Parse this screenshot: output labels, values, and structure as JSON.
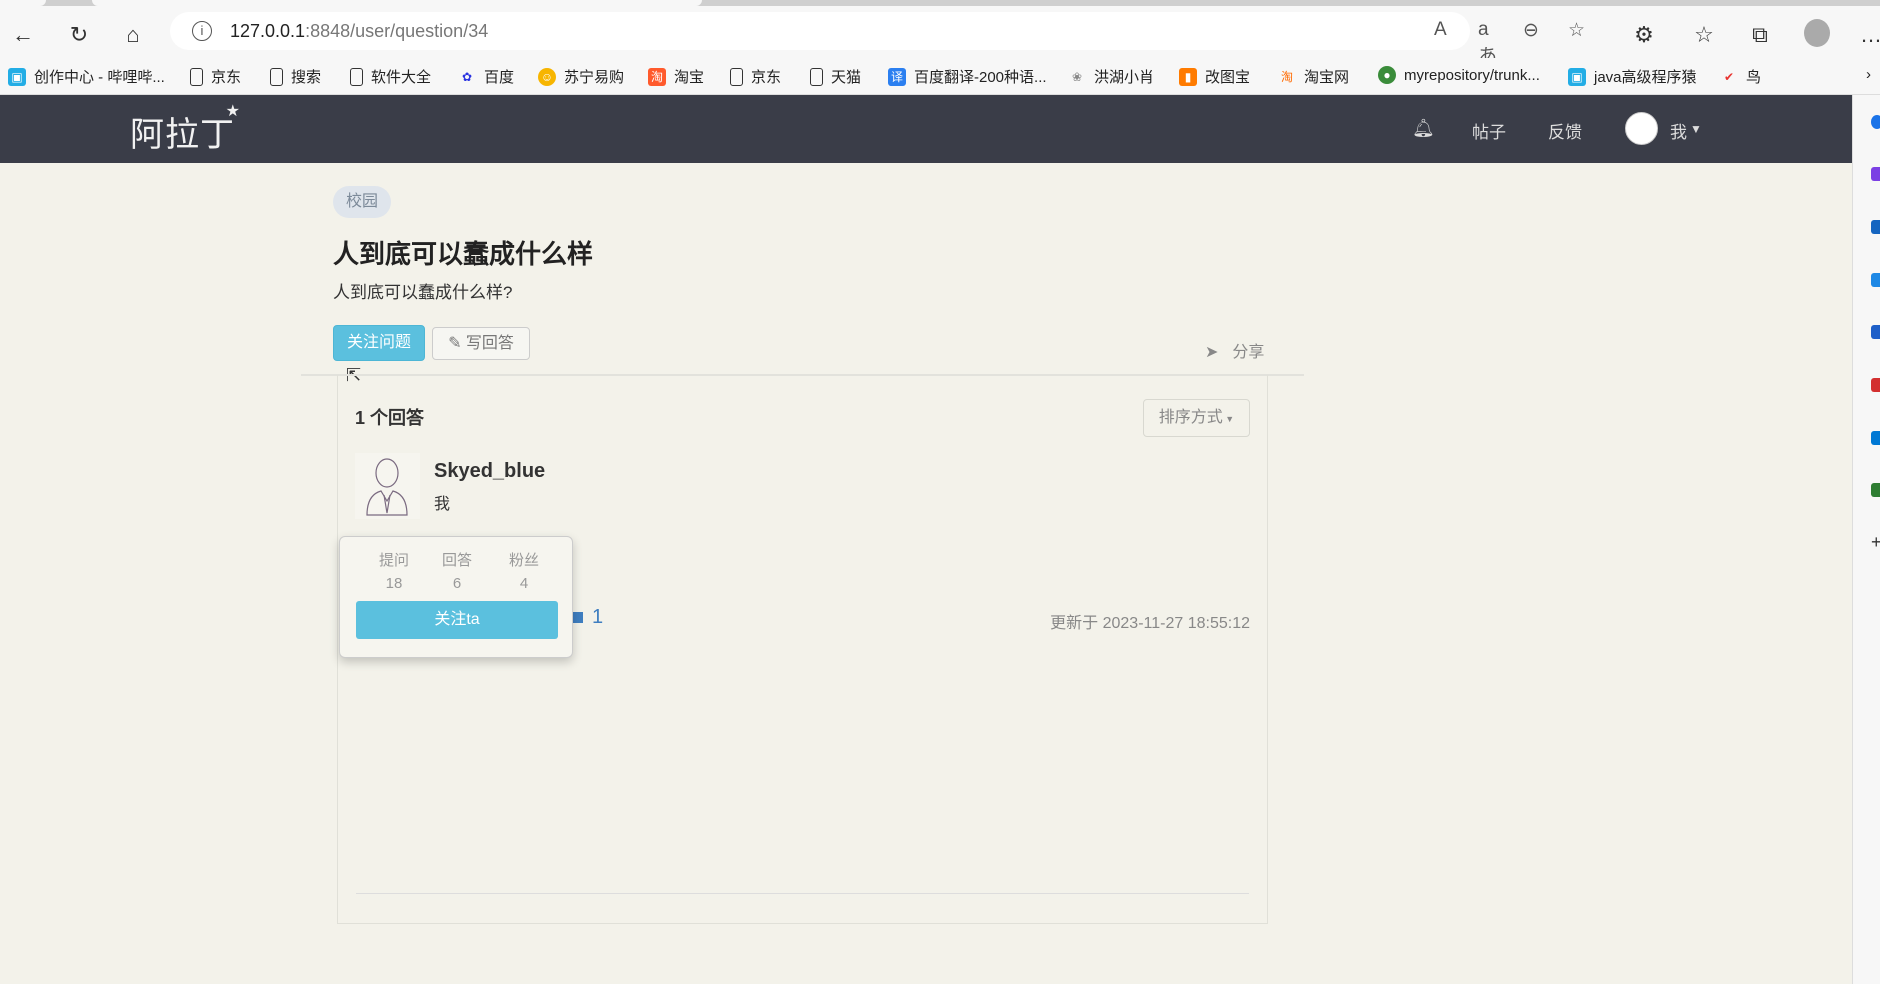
{
  "browser": {
    "url_host": "127.0.0.1",
    "url_rest": ":8848/user/question/34",
    "bookmarks": [
      "创作中心 - 哔哩哔...",
      "京东",
      "搜索",
      "软件大全",
      "百度",
      "苏宁易购",
      "淘宝",
      "京东",
      "天猫",
      "百度翻译-200种语...",
      "洪湖小肖",
      "改图宝",
      "淘宝网",
      "myrepository/trunk...",
      "java高级程序猿",
      "鸟"
    ]
  },
  "nav": {
    "logo": "阿拉丁",
    "posts": "帖子",
    "feedback": "反馈",
    "me": "我"
  },
  "question": {
    "tag": "校园",
    "title": "人到底可以蠢成什么样",
    "description": "人到底可以蠢成什么样?",
    "follow_label": "关注问题",
    "write_label": "写回答",
    "share_label": "分享"
  },
  "answers": {
    "count_label": "1 个回答",
    "sort_label": "排序方式",
    "items": [
      {
        "author": "Skyed_blue",
        "content": "我",
        "votes": "1",
        "updated": "更新于 2023-11-27 18:55:12"
      }
    ]
  },
  "popover": {
    "stats": [
      {
        "label": "提问",
        "value": "18"
      },
      {
        "label": "回答",
        "value": "6"
      },
      {
        "label": "粉丝",
        "value": "4"
      }
    ],
    "follow_label": "关注ta"
  },
  "colors": {
    "accent": "#5bc0de",
    "nav_bg": "#3a3d48",
    "page_bg": "#f3f2ea",
    "link": "#3f7ec0"
  }
}
